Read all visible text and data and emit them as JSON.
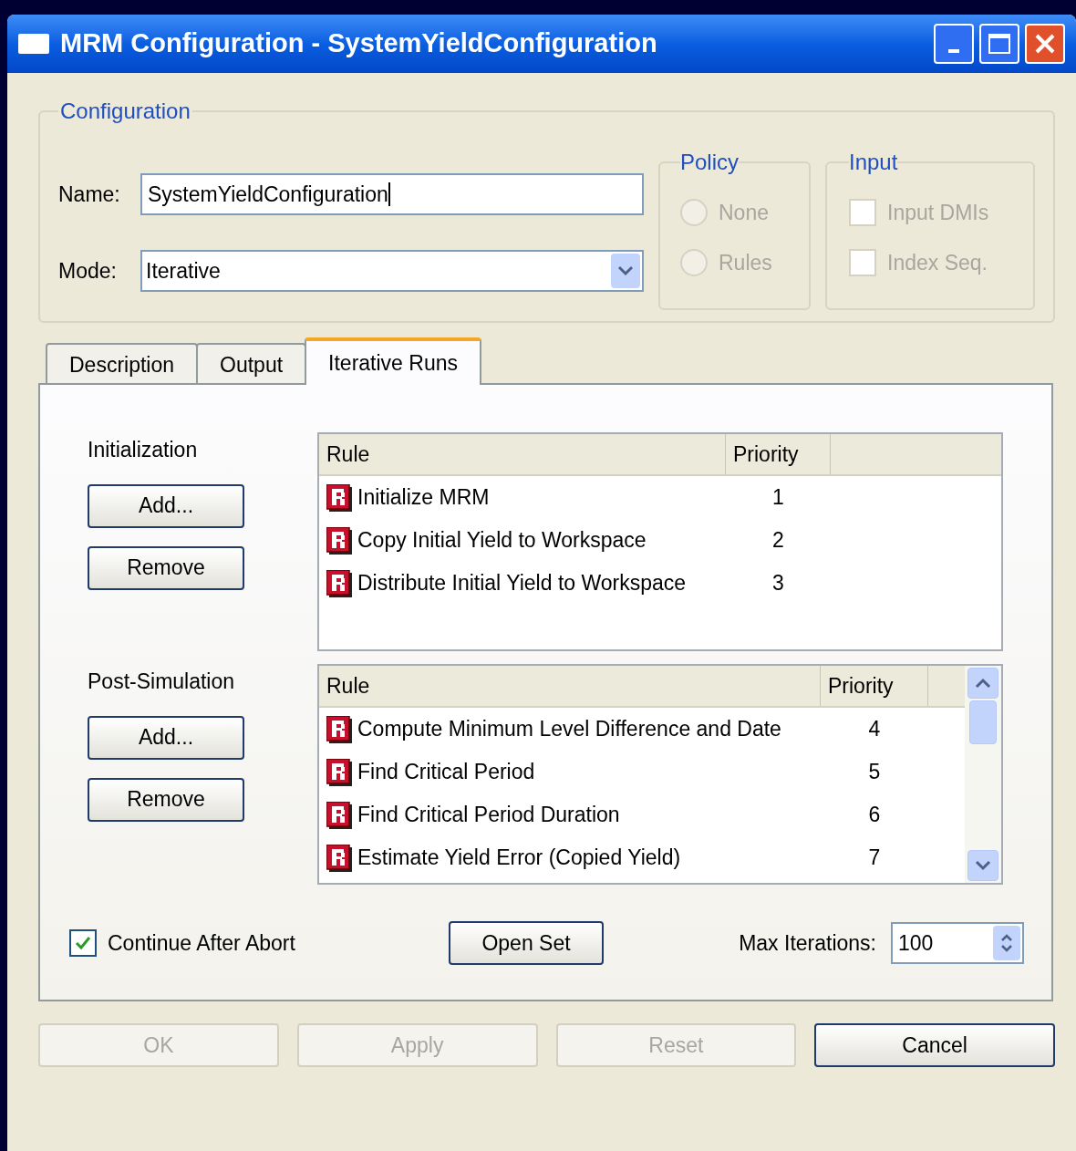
{
  "window": {
    "title": "MRM Configuration - SystemYieldConfiguration"
  },
  "configuration": {
    "legend": "Configuration",
    "name_label": "Name:",
    "name_value": "SystemYieldConfiguration",
    "mode_label": "Mode:",
    "mode_value": "Iterative",
    "policy": {
      "legend": "Policy",
      "disabled": true,
      "options": [
        {
          "label": "None",
          "selected": false
        },
        {
          "label": "Rules",
          "selected": false
        }
      ]
    },
    "input": {
      "legend": "Input",
      "disabled": true,
      "options": [
        {
          "label": "Input DMIs",
          "checked": false
        },
        {
          "label": "Index Seq.",
          "checked": false
        }
      ]
    }
  },
  "tabs": [
    {
      "label": "Description",
      "selected": false
    },
    {
      "label": "Output",
      "selected": false
    },
    {
      "label": "Iterative Runs",
      "selected": true
    }
  ],
  "sections": [
    {
      "title": "Initialization",
      "buttons": [
        "Add...",
        "Remove"
      ],
      "columns": [
        "Rule",
        "Priority"
      ],
      "rows": [
        {
          "rule": "Initialize MRM",
          "priority": "1"
        },
        {
          "rule": "Copy Initial Yield to Workspace",
          "priority": "2"
        },
        {
          "rule": "Distribute Initial Yield to Workspace",
          "priority": "3"
        }
      ]
    },
    {
      "title": "Post-Simulation",
      "buttons": [
        "Add...",
        "Remove"
      ],
      "columns": [
        "Rule",
        "Priority"
      ],
      "rows": [
        {
          "rule": "Compute Minimum Level Difference and Date",
          "priority": "4"
        },
        {
          "rule": "Find Critical Period",
          "priority": "5"
        },
        {
          "rule": "Find Critical Period Duration",
          "priority": "6"
        },
        {
          "rule": "Estimate Yield Error (Copied Yield)",
          "priority": "7"
        }
      ]
    }
  ],
  "continue_after_abort": {
    "label": "Continue After Abort",
    "checked": true
  },
  "open_set_button": "Open Set",
  "max_iterations": {
    "label": "Max Iterations:",
    "value": "100"
  },
  "footer_buttons": [
    {
      "label": "OK",
      "disabled": true
    },
    {
      "label": "Apply",
      "disabled": true
    },
    {
      "label": "Reset",
      "disabled": true
    },
    {
      "label": "Cancel",
      "disabled": false
    }
  ]
}
